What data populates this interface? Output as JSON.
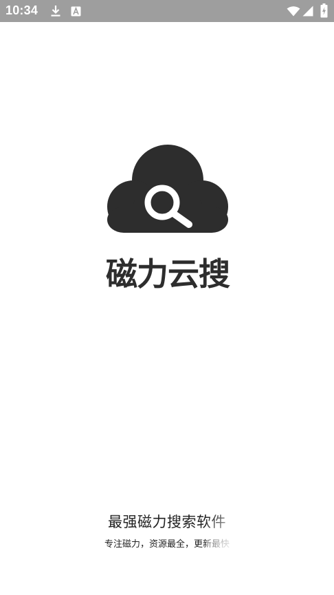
{
  "status_bar": {
    "time": "10:34",
    "left_icons": [
      "download-icon",
      "text-a-icon"
    ],
    "right_icons": [
      "wifi-icon",
      "signal-icon",
      "battery-charging-icon"
    ],
    "background_color": "#9e9e9e"
  },
  "splash": {
    "logo_icon": "cloud-search-icon",
    "app_name": "磁力云搜",
    "slogan": "最强磁力搜索软件",
    "subslogan": "专注磁力，资源最全，更新最快"
  },
  "colors": {
    "logo": "#2d2d2d",
    "text": "#222222",
    "background": "#ffffff"
  }
}
